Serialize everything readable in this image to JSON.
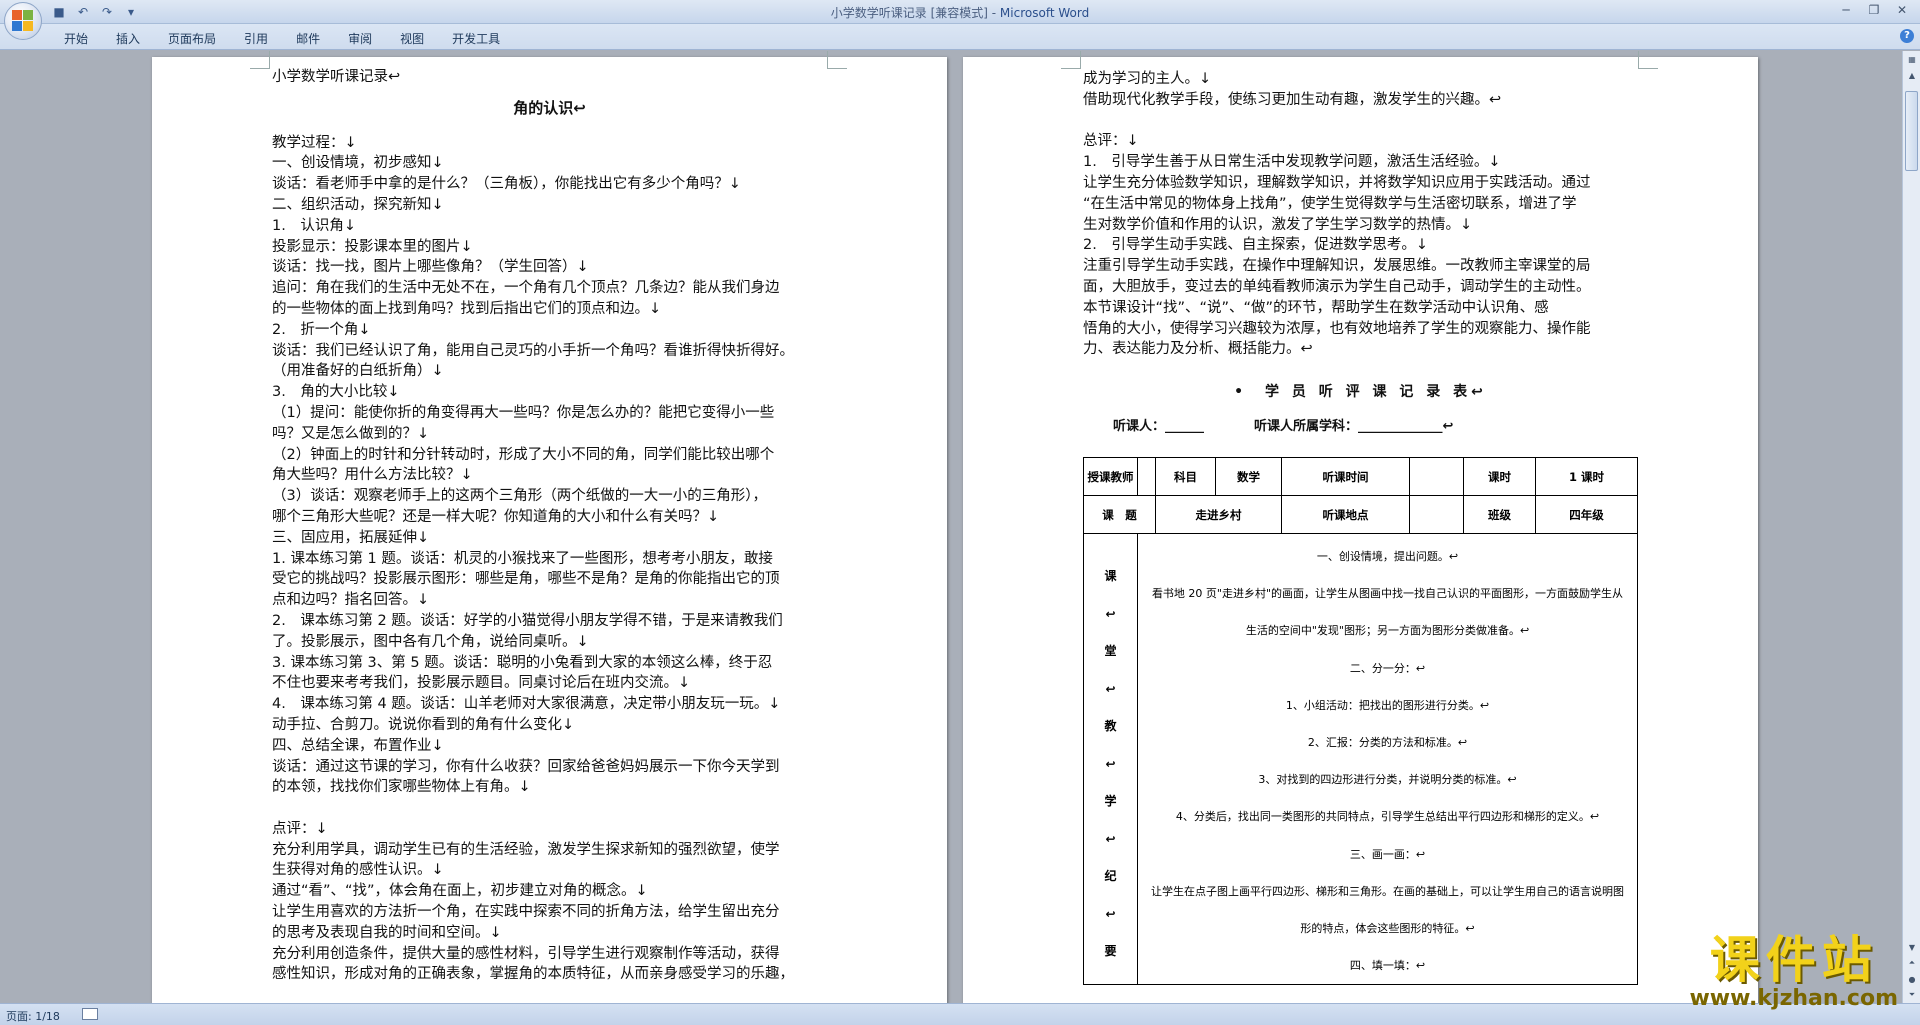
{
  "window": {
    "title": "小学数学听课记录 [兼容模式] - ",
    "app_name": "Microsoft Word"
  },
  "qat": {
    "save_icon": "save-icon",
    "undo_icon": "undo-icon",
    "redo_icon": "redo-icon",
    "customize_icon": "customize-icon"
  },
  "ribbon": {
    "tabs": [
      "开始",
      "插入",
      "页面布局",
      "引用",
      "邮件",
      "审阅",
      "视图",
      "开发工具"
    ],
    "help": "?"
  },
  "page1": {
    "header": "小学数学听课记录↩",
    "title": "角的认识↩",
    "lines": [
      "教学过程：↓",
      "一、创设情境，初步感知↓",
      "谈话：看老师手中拿的是什么？（三角板），你能找出它有多少个角吗？↓",
      "二、组织活动，探究新知↓",
      "1.　认识角↓",
      "投影显示：投影课本里的图片↓",
      "谈话：找一找，图片上哪些像角？（学生回答）↓",
      "追问：角在我们的生活中无处不在，一个角有几个顶点？几条边？能从我们身边",
      "的一些物体的面上找到角吗？找到后指出它们的顶点和边。↓",
      "2.　折一个角↓",
      "谈话：我们已经认识了角，能用自己灵巧的小手折一个角吗？看谁折得快折得好。",
      "（用准备好的白纸折角）↓",
      "3.　角的大小比较↓",
      "（1）提问：能使你折的角变得再大一些吗？你是怎么办的？能把它变得小一些",
      "吗？又是怎么做到的？↓",
      "（2）钟面上的时针和分针转动时，形成了大小不同的角，同学们能比较出哪个",
      "角大些吗？用什么方法比较？↓",
      "（3）谈话：观察老师手上的这两个三角形（两个纸做的一大一小的三角形），",
      "哪个三角形大些呢？还是一样大呢？你知道角的大小和什么有关吗？↓",
      "三、固应用，拓展延伸↓",
      "1. 课本练习第 1 题。谈话：机灵的小猴找来了一些图形，想考考小朋友，敢接",
      "受它的挑战吗？投影展示图形：哪些是角，哪些不是角？是角的你能指出它的顶",
      "点和边吗？指名回答。↓",
      "2.　课本练习第 2 题。谈话：好学的小猫觉得小朋友学得不错，于是来请教我们",
      "了。投影展示，图中各有几个角，说给同桌听。↓",
      "3. 课本练习第 3、第 5 题。谈话：聪明的小兔看到大家的本领这么棒，终于忍",
      "不住也要来考考我们，投影展示题目。同桌讨论后在班内交流。↓",
      "4.　课本练习第 4 题。谈话：山羊老师对大家很满意，决定带小朋友玩一玩。↓",
      "动手拉、合剪刀。说说你看到的角有什么变化↓",
      "四、总结全课，布置作业↓",
      "谈话：通过这节课的学习，你有什么收获？回家给爸爸妈妈展示一下你今天学到",
      "的本领，找找你们家哪些物体上有角。↓",
      "",
      "点评：↓",
      "充分利用学具，调动学生已有的生活经验，激发学生探求新知的强烈欲望，使学",
      "生获得对角的感性认识。↓",
      "通过“看”、“找”，体会角在面上，初步建立对角的概念。↓",
      "让学生用喜欢的方法折一个角，在实践中探索不同的折角方法，给学生留出充分",
      "的思考及表现自我的时间和空间。↓",
      "充分利用创造条件，提供大量的感性材料，引导学生进行观察制作等活动，获得",
      "感性知识，形成对角的正确表象，掌握角的本质特征，从而亲身感受学习的乐趣，"
    ]
  },
  "page2": {
    "lines": [
      "成为学习的主人。↓",
      "借助现代化教学手段，使练习更加生动有趣，激发学生的兴趣。↩",
      "",
      "总评：↓",
      "1.　引导学生善于从日常生活中发现教学问题，激活生活经验。↓",
      "让学生充分体验数学知识，理解数学知识，并将数学知识应用于实践活动。通过",
      "“在生活中常见的物体身上找角”，使学生觉得数学与生活密切联系，增进了学",
      "生对数学价值和作用的认识，激发了学生学习数学的热情。↓",
      "2.　引导学生动手实践、自主探索，促进数学思考。↓",
      "注重引导学生动手实践，在操作中理解知识，发展思维。一改教师主宰课堂的局",
      "面，大胆放手，变过去的单纯看教师演示为学生自己动手，调动学生的主动性。",
      "本节课设计“找”、“说”、“做”的环节，帮助学生在数学活动中认识角、感",
      "悟角的大小，使得学习兴趣较为浓厚，也有效地培养了学生的观察能力、操作能",
      "力、表达能力及分析、概括能力。↩"
    ],
    "form_title": "•　学 员 听 评 课 记 录 表↩",
    "listener": "听课人：______",
    "listener_subject": "听课人所属学科：_____________↩",
    "table": {
      "row1": [
        "授课教师",
        "",
        "科目",
        "数学",
        "听课时间",
        "",
        "课时",
        "1 课时"
      ],
      "row2": [
        "课　题",
        "走进乡村",
        "听课地点",
        "",
        "班级",
        "四年级"
      ],
      "side_label": [
        "课",
        "↩",
        "堂",
        "↩",
        "教",
        "↩",
        "学",
        "↩",
        "纪",
        "↩",
        "要"
      ],
      "content": [
        "一、创设情境，提出问题。↩",
        "看书地 20 页\"走进乡村\"的画面，让学生从图画中找一找自己认识的平面图形，一方面鼓励学生从",
        "生活的空间中\"发现\"图形；另一方面为图形分类做准备。↩",
        "二、分一分：↩",
        "1、小组活动：把找出的图形进行分类。↩",
        "2、汇报：分类的方法和标准。↩",
        "3、对找到的四边形进行分类，并说明分类的标准。↩",
        "4、分类后，找出同一类图形的共同特点，引导学生总结出平行四边形和梯形的定义。↩",
        "三、画一画：↩",
        "让学生在点子图上画平行四边形、梯形和三角形。在画的基础上，可以让学生用自己的语言说明图",
        "形的特点，体会这些图形的特征。↩",
        "四、填一填：↩"
      ]
    }
  },
  "statusbar": {
    "page": "页面: 1/18"
  },
  "watermark": {
    "text": "课件站",
    "url": "www.kjzhan.com"
  }
}
